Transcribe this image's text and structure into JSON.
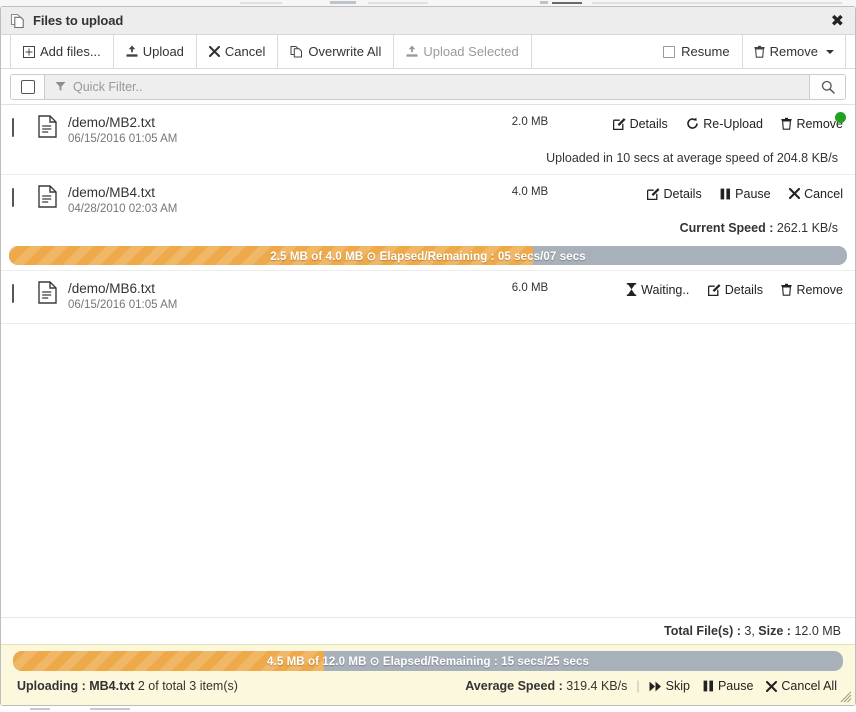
{
  "dialog": {
    "title": "Files to upload",
    "title_icon": "copy-files-icon",
    "close_label": "✖"
  },
  "toolbar": {
    "add_files": "Add files...",
    "upload": "Upload",
    "cancel": "Cancel",
    "overwrite_all": "Overwrite All",
    "upload_selected": "Upload Selected",
    "resume": "Resume",
    "remove": "Remove"
  },
  "filter": {
    "placeholder": "Quick Filter..",
    "value": "",
    "search_icon": "magnifier-icon",
    "funnel_icon": "funnel-icon"
  },
  "files": [
    {
      "name": "/demo/MB2.txt",
      "date": "06/15/2016 01:05 AM",
      "size": "2.0 MB",
      "state": "done",
      "actions": [
        "Details",
        "Re-Upload",
        "Remove"
      ],
      "note_prefix": "",
      "note": "Uploaded in 10 secs at average speed of 204.8 KB/s"
    },
    {
      "name": "/demo/MB4.txt",
      "date": "04/28/2010 02:03 AM",
      "size": "4.0 MB",
      "state": "uploading",
      "actions": [
        "Details",
        "Pause",
        "Cancel"
      ],
      "note_prefix": "Current Speed :",
      "note": "262.1 KB/s",
      "progress": {
        "percent": 62.5,
        "label": "2.5 MB of 4.0 MB ⊙ Elapsed/Remaining : 05 secs/07 secs"
      }
    },
    {
      "name": "/demo/MB6.txt",
      "date": "06/15/2016 01:05 AM",
      "size": "6.0 MB",
      "state": "waiting",
      "waiting_label": "Waiting..",
      "actions": [
        "Details",
        "Remove"
      ]
    }
  ],
  "totals": {
    "files_label": "Total File(s) :",
    "files_value": "3,",
    "size_label": "Size :",
    "size_value": "12.0 MB"
  },
  "footer": {
    "progress": {
      "percent": 37.5,
      "label": "4.5 MB of 12.0 MB ⊙ Elapsed/Remaining : 15 secs/25 secs"
    },
    "uploading_label": "Uploading :",
    "uploading_file": "MB4.txt",
    "uploading_count": "2 of total 3 item(s)",
    "avg_speed_label": "Average Speed :",
    "avg_speed_value": "319.4 KB/s",
    "skip": "Skip",
    "pause": "Pause",
    "cancel_all": "Cancel All"
  },
  "colors": {
    "progress_fill": "#eda94a",
    "progress_track": "#a8b0ba",
    "footer_bg": "#fbf8dd",
    "status_done": "#21a121",
    "titlebar_bg": "#ededed"
  }
}
